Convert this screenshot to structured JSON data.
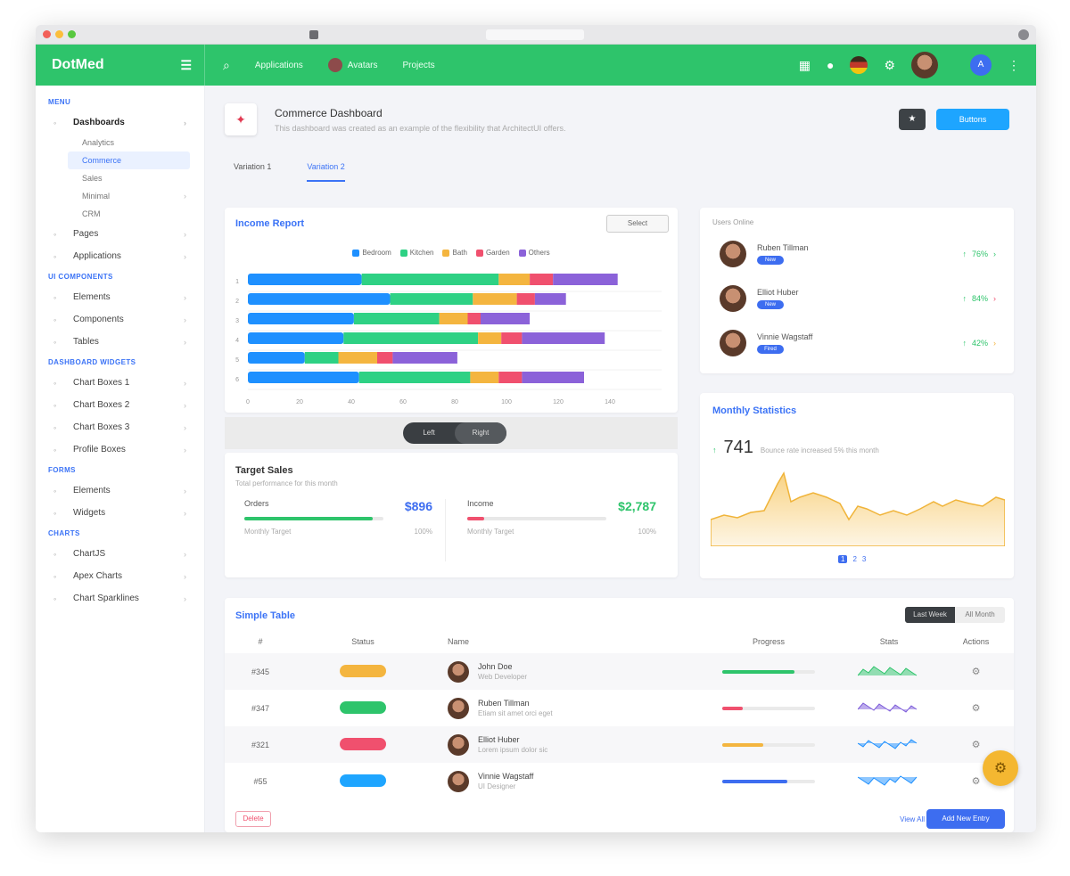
{
  "browser": {
    "url": ""
  },
  "topbar": {
    "brand": "DotMed",
    "nav": [
      "Applications",
      "Avatars",
      "Projects"
    ],
    "user_name": "",
    "user_role": "",
    "user_initial": "A"
  },
  "sidebar": {
    "sections": [
      {
        "title": "MENU",
        "items": [
          {
            "label": "Dashboards",
            "icon": "home-icon",
            "bold": true,
            "sub": [
              "Analytics",
              "Commerce",
              "Sales",
              "Minimal",
              "CRM"
            ]
          },
          {
            "label": "Pages",
            "icon": "file-icon"
          },
          {
            "label": "Applications",
            "icon": "grid-icon"
          }
        ]
      },
      {
        "title": "UI COMPONENTS",
        "items": [
          {
            "label": "Elements",
            "icon": "box-icon"
          },
          {
            "label": "Components",
            "icon": "layers-icon"
          },
          {
            "label": "Tables",
            "icon": "table-icon"
          }
        ]
      },
      {
        "title": "DASHBOARD WIDGETS",
        "items": [
          {
            "label": "Chart Boxes 1",
            "icon": "chart-icon"
          },
          {
            "label": "Chart Boxes 2",
            "icon": "chart-icon"
          },
          {
            "label": "Chart Boxes 3",
            "icon": "chart-icon"
          },
          {
            "label": "Profile Boxes",
            "icon": "user-icon"
          }
        ]
      },
      {
        "title": "FORMS",
        "items": [
          {
            "label": "Elements",
            "icon": "edit-icon"
          },
          {
            "label": "Widgets",
            "icon": "widget-icon"
          }
        ]
      },
      {
        "title": "CHARTS",
        "items": [
          {
            "label": "ChartJS",
            "icon": "pie-icon"
          },
          {
            "label": "Apex Charts",
            "icon": "bar-icon"
          },
          {
            "label": "Chart Sparklines",
            "icon": "spark-icon"
          }
        ]
      }
    ]
  },
  "page": {
    "title": "Commerce Dashboard",
    "subtitle": "This dashboard was created as an example of the flexibility that ArchitectUI offers.",
    "primary_button": "Buttons",
    "tabs": [
      "Variation 1",
      "Variation 2"
    ]
  },
  "income": {
    "title": "Income Report",
    "select": "Select",
    "legend": [
      {
        "name": "Bedroom",
        "color": "#1e90ff"
      },
      {
        "name": "Kitchen",
        "color": "#2ed184"
      },
      {
        "name": "Bath",
        "color": "#f4b53f"
      },
      {
        "name": "Garden",
        "color": "#f0506e"
      },
      {
        "name": "Others",
        "color": "#8b62d9"
      }
    ]
  },
  "chart_data": {
    "type": "bar",
    "orientation": "horizontal",
    "stacked": true,
    "categories": [
      "1",
      "2",
      "3",
      "4",
      "5",
      "6"
    ],
    "series": [
      {
        "name": "Bedroom",
        "values": [
          44,
          55,
          41,
          37,
          22,
          43
        ]
      },
      {
        "name": "Kitchen",
        "values": [
          53,
          32,
          33,
          52,
          13,
          43
        ]
      },
      {
        "name": "Bath",
        "values": [
          12,
          17,
          11,
          9,
          15,
          11
        ]
      },
      {
        "name": "Garden",
        "values": [
          9,
          7,
          5,
          8,
          6,
          9
        ]
      },
      {
        "name": "Others",
        "values": [
          25,
          12,
          19,
          32,
          25,
          24
        ]
      }
    ],
    "xticks": [
      "0",
      "20",
      "40",
      "60",
      "80",
      "100",
      "120",
      "140"
    ],
    "xlim": [
      0,
      160
    ]
  },
  "toggle": [
    "Left",
    "Right"
  ],
  "target": {
    "title": "Target Sales",
    "subtitle": "Total performance for this month",
    "boxes": [
      {
        "label": "Orders",
        "value": "$896",
        "color": "#3d6df0",
        "fill": 0.92,
        "bar_color": "#2ec46b",
        "sub": "Monthly Target",
        "pct": "100%"
      },
      {
        "label": "Income",
        "value": "$2,787",
        "color": "#2ec46b",
        "fill": 0.12,
        "bar_color": "#f0506e",
        "sub": "Monthly Target",
        "pct": "100%"
      }
    ]
  },
  "users": {
    "title": "Users Online",
    "rows": [
      {
        "name": "Ruben Tillman",
        "badge": "New",
        "stat": "76%"
      },
      {
        "name": "Elliot Huber",
        "badge": "New",
        "stat": "84%"
      },
      {
        "name": "Vinnie Wagstaff",
        "badge": "Fired",
        "stat": "42%"
      }
    ]
  },
  "monthly": {
    "title": "Monthly Statistics",
    "value": "741",
    "caption": "Bounce rate increased 5% this month",
    "pages": [
      "1",
      "2",
      "3"
    ]
  },
  "table": {
    "title": "Simple Table",
    "toggle": [
      "Last Week",
      "All Month"
    ],
    "headers": [
      "#",
      "Status",
      "Name",
      "Progress",
      "Stats",
      "Actions"
    ],
    "rows": [
      {
        "id": "#345",
        "status_color": "#f4b53f",
        "name": "John Doe",
        "sub": "Web Developer",
        "progress": 0.78,
        "bar_color": "#2ec46b",
        "spark_color": "#2ec46b"
      },
      {
        "id": "#347",
        "status_color": "#2ec46b",
        "name": "Ruben Tillman",
        "sub": "Etiam sit amet orci eget",
        "progress": 0.22,
        "bar_color": "#f0506e",
        "spark_color": "#7b5ad9"
      },
      {
        "id": "#321",
        "status_color": "#f0506e",
        "name": "Elliot Huber",
        "sub": "Lorem ipsum dolor sic",
        "progress": 0.44,
        "bar_color": "#f4b53f",
        "spark_color": "#1e90ff"
      },
      {
        "id": "#55",
        "status_color": "#1ea5ff",
        "name": "Vinnie Wagstaff",
        "sub": "UI Designer",
        "progress": 0.7,
        "bar_color": "#3d6df0",
        "spark_color": "#1e90ff"
      }
    ],
    "delete": "Delete",
    "view_all": "View All",
    "add_new": "Add New Entry"
  }
}
